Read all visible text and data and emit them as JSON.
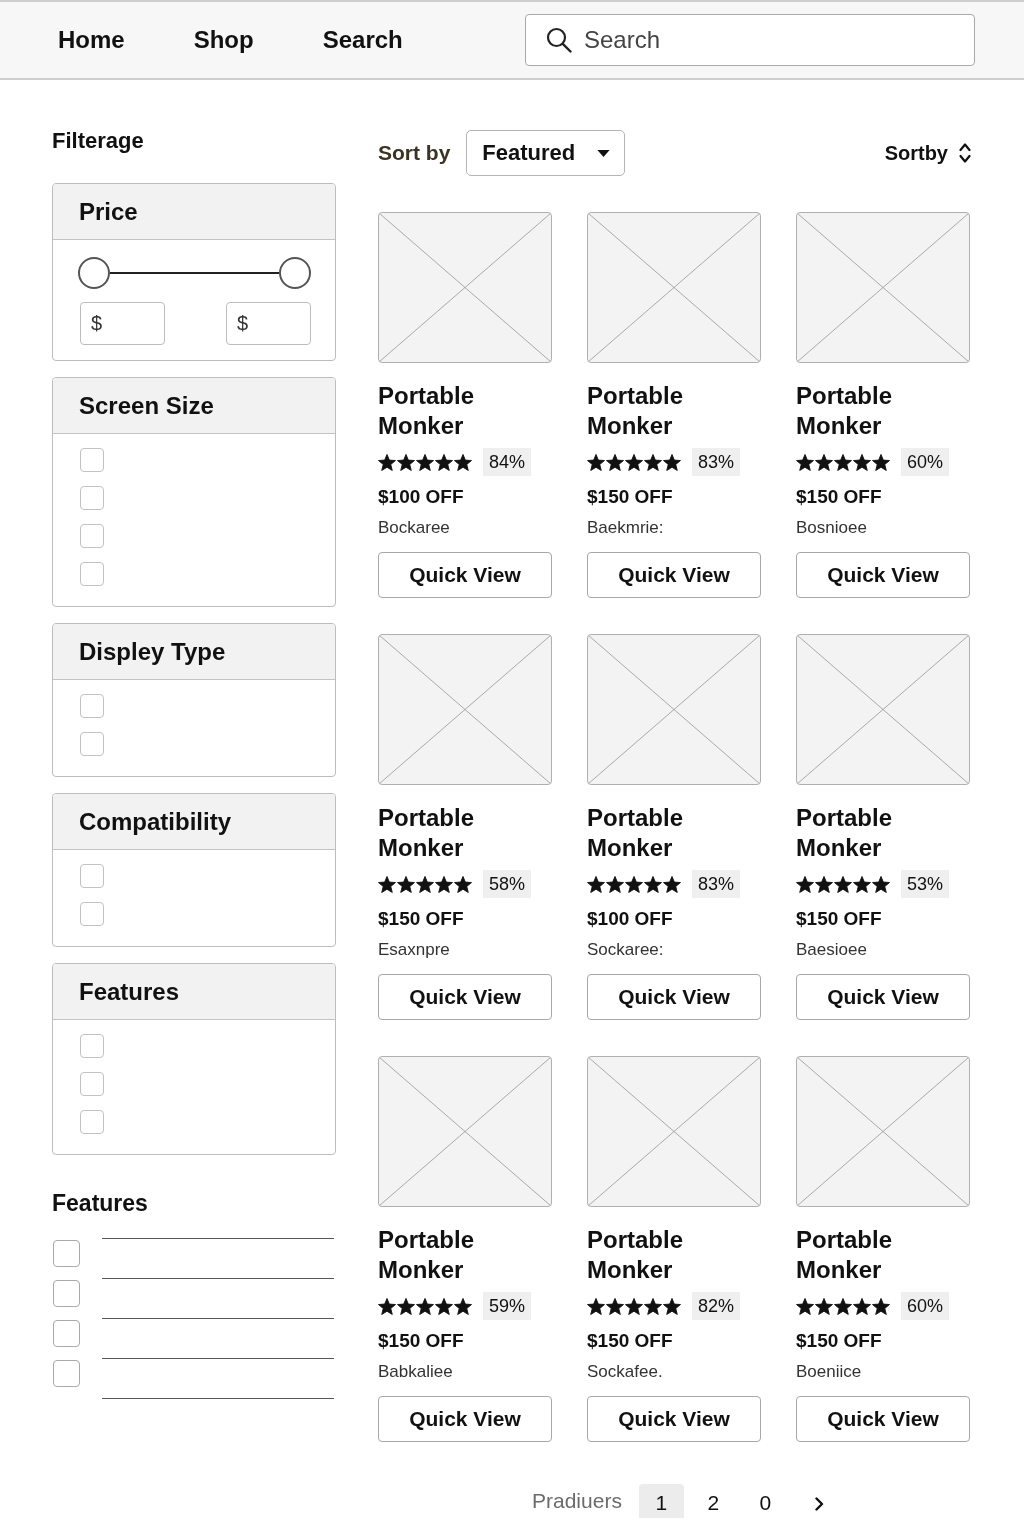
{
  "nav": {
    "links": [
      {
        "label": "Home"
      },
      {
        "label": "Shop"
      },
      {
        "label": "Search"
      }
    ],
    "search": {
      "placeholder": "Search"
    }
  },
  "sidebar": {
    "title": "Filterage",
    "panels": [
      {
        "title": "Price",
        "kind": "range",
        "handles": [
          {
            "level": 0
          },
          {
            "level": 1
          }
        ],
        "inputs": [
          {
            "placeholder": "$"
          },
          {
            "placeholder": "$"
          }
        ]
      },
      {
        "title": "Screen Size",
        "kind": "checkboxes",
        "options": [
          {
            "checked": false
          },
          {
            "checked": false
          },
          {
            "checked": false
          },
          {
            "checked": false
          }
        ]
      },
      {
        "title": "Displey Type",
        "kind": "checkboxes",
        "options": [
          {
            "checked": false
          },
          {
            "checked": false
          }
        ]
      },
      {
        "title": "Compatibility",
        "kind": "checkboxes",
        "options": [
          {
            "checked": false
          },
          {
            "checked": false
          }
        ]
      },
      {
        "title": "Features",
        "kind": "checkboxes",
        "options": [
          {
            "checked": false
          },
          {
            "checked": false
          },
          {
            "checked": false
          }
        ]
      }
    ],
    "features": {
      "title": "Features",
      "options": [
        {
          "checked": false
        },
        {
          "checked": false
        },
        {
          "checked": false
        },
        {
          "checked": false
        }
      ]
    }
  },
  "toolbar": {
    "sort_label": "Sort by",
    "sort_value": "Featured",
    "sort_toggle": "Sortby"
  },
  "products": [
    {
      "name": "Portable Monker",
      "stars": 5,
      "rating": "84%",
      "discount": "$100 OFF",
      "brand": "Bockaree",
      "button": "Quick View"
    },
    {
      "name": "Portable Monker",
      "stars": 5,
      "rating": "83%",
      "discount": "$150 OFF",
      "brand": "Baekmrie:",
      "button": "Quick View"
    },
    {
      "name": "Portable Monker",
      "stars": 5,
      "rating": "60%",
      "discount": "$150 OFF",
      "brand": "Bosnioee",
      "button": "Quick View"
    },
    {
      "name": "Portable Monker",
      "stars": 5,
      "rating": "58%",
      "discount": "$150 OFF",
      "brand": "Esaxnpre",
      "button": "Quick View"
    },
    {
      "name": "Portable Monker",
      "stars": 5,
      "rating": "83%",
      "discount": "$100 OFF",
      "brand": "Sockaree:",
      "button": "Quick View"
    },
    {
      "name": "Portable Monker",
      "stars": 5,
      "rating": "53%",
      "discount": "$150 OFF",
      "brand": "Baesioee",
      "button": "Quick View"
    },
    {
      "name": "Portable Monker",
      "stars": 5,
      "rating": "59%",
      "discount": "$150 OFF",
      "brand": "Babkaliee",
      "button": "Quick View"
    },
    {
      "name": "Portable Monker",
      "stars": 5,
      "rating": "82%",
      "discount": "$150 OFF",
      "brand": "Sockafee.",
      "button": "Quick View"
    },
    {
      "name": "Portable Monker",
      "stars": 5,
      "rating": "60%",
      "discount": "$150 OFF",
      "brand": "Boeniice",
      "button": "Quick View"
    }
  ],
  "pagination": {
    "label": "Pradiuers",
    "pages": [
      {
        "label": "1",
        "selected": true
      },
      {
        "label": "2",
        "selected": false
      },
      {
        "label": "0",
        "selected": false
      }
    ]
  }
}
